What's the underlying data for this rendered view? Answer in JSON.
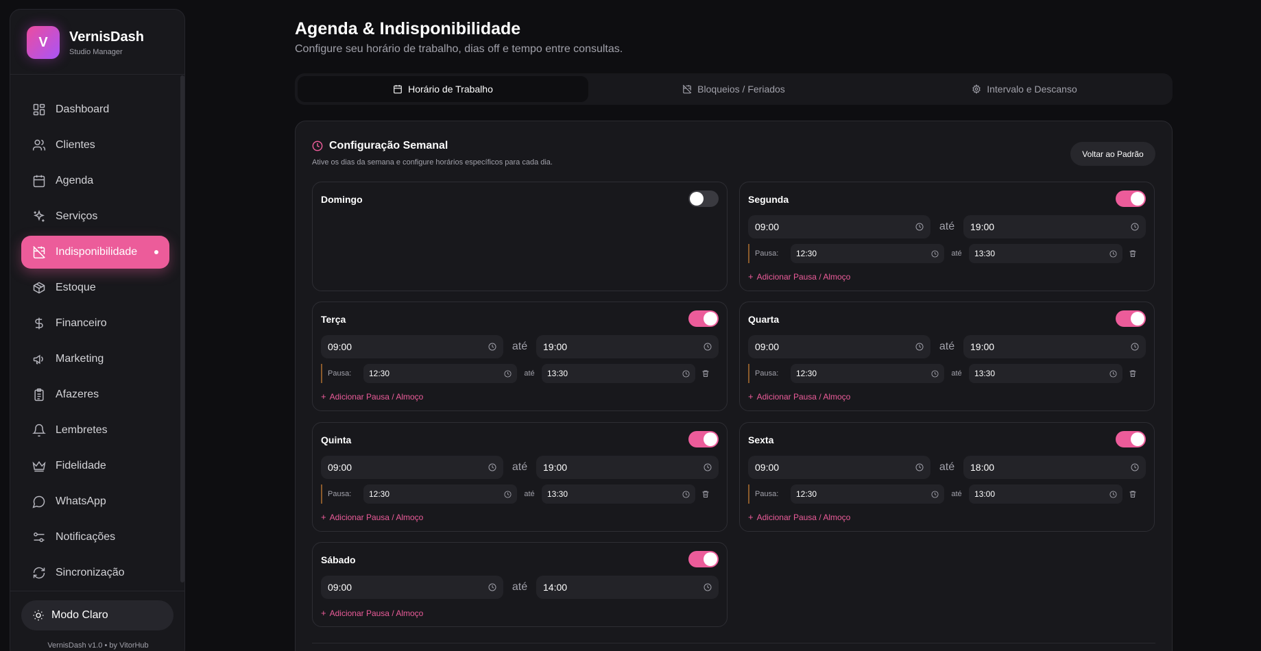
{
  "brand": {
    "logo_letter": "V",
    "name": "VernisDash",
    "subtitle": "Studio Manager"
  },
  "nav": [
    {
      "label": "Dashboard",
      "icon": "grid-icon"
    },
    {
      "label": "Clientes",
      "icon": "users-icon"
    },
    {
      "label": "Agenda",
      "icon": "calendar-icon"
    },
    {
      "label": "Serviços",
      "icon": "sparkles-icon"
    },
    {
      "label": "Indisponibilidade",
      "icon": "calendar-off-icon",
      "active": true
    },
    {
      "label": "Estoque",
      "icon": "package-icon"
    },
    {
      "label": "Financeiro",
      "icon": "dollar-icon"
    },
    {
      "label": "Marketing",
      "icon": "megaphone-icon"
    },
    {
      "label": "Afazeres",
      "icon": "clipboard-icon"
    },
    {
      "label": "Lembretes",
      "icon": "bell-icon"
    },
    {
      "label": "Fidelidade",
      "icon": "crown-icon"
    },
    {
      "label": "WhatsApp",
      "icon": "message-icon"
    },
    {
      "label": "Notificações",
      "icon": "sliders-icon"
    },
    {
      "label": "Sincronização",
      "icon": "refresh-icon"
    }
  ],
  "theme_toggle": {
    "label": "Modo Claro",
    "icon": "sun-icon"
  },
  "footer": {
    "version": "VernisDash v1.0 • by VitorHub"
  },
  "header": {
    "title": "Agenda & Indisponibilidade",
    "subtitle": "Configure seu horário de trabalho, dias off e tempo entre consultas."
  },
  "tabs": [
    {
      "label": "Horário de Trabalho",
      "icon": "calendar-icon",
      "active": true
    },
    {
      "label": "Bloqueios / Feriados",
      "icon": "calendar-off-icon"
    },
    {
      "label": "Intervalo e Descanso",
      "icon": "gear-icon"
    }
  ],
  "weekly": {
    "title": "Configuração Semanal",
    "subtitle": "Ative os dias da semana e configure horários específicos para cada dia.",
    "reset_label": "Voltar ao Padrão",
    "ate": "até",
    "pause_label": "Pausa:",
    "add_pause": "Adicionar Pausa / Almoço",
    "days": [
      {
        "name": "Domingo",
        "enabled": false
      },
      {
        "name": "Segunda",
        "enabled": true,
        "start": "09:00",
        "end": "19:00",
        "pause_start": "12:30",
        "pause_end": "13:30"
      },
      {
        "name": "Terça",
        "enabled": true,
        "start": "09:00",
        "end": "19:00",
        "pause_start": "12:30",
        "pause_end": "13:30"
      },
      {
        "name": "Quarta",
        "enabled": true,
        "start": "09:00",
        "end": "19:00",
        "pause_start": "12:30",
        "pause_end": "13:30"
      },
      {
        "name": "Quinta",
        "enabled": true,
        "start": "09:00",
        "end": "19:00",
        "pause_start": "12:30",
        "pause_end": "13:30"
      },
      {
        "name": "Sexta",
        "enabled": true,
        "start": "09:00",
        "end": "18:00",
        "pause_start": "12:30",
        "pause_end": "13:00"
      },
      {
        "name": "Sábado",
        "enabled": true,
        "start": "09:00",
        "end": "14:00"
      }
    ]
  },
  "colors": {
    "accent": "#ec5c9a",
    "background": "#0e0e11",
    "card": "#18181c"
  }
}
